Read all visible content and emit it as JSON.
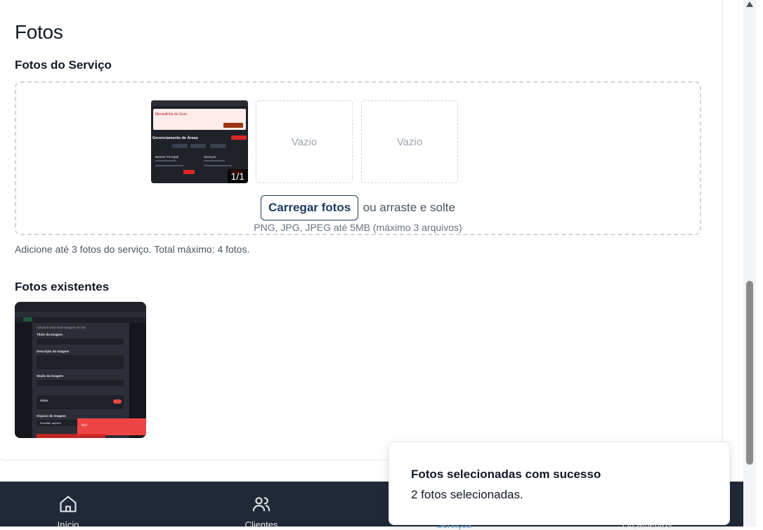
{
  "page": {
    "title": "Fotos",
    "service_photos_label": "Fotos do Serviço",
    "existing_photos_label": "Fotos existentes",
    "helper_text": "Adicione até 3 fotos do serviço. Total máximo: 4 fotos."
  },
  "dropzone": {
    "slots": [
      {
        "state": "filled",
        "counter": "1/1"
      },
      {
        "state": "empty",
        "label": "Vazio"
      },
      {
        "state": "empty",
        "label": "Vazio"
      }
    ],
    "upload_button": "Carregar fotos",
    "drag_text": "ou arraste e solte",
    "hint": "PNG, JPG, JPEG até 5MB (máximo 3 arquivos)"
  },
  "thumbnail_preview": {
    "title": "Gerenciamento de Áreas",
    "alert_title": "Mensalinha do Guru",
    "card1": "Banner Principal",
    "card2": "Serviços"
  },
  "existing_preview": {
    "lines": [
      "Adicione uma nova imagem ao site",
      "Título da Imagem",
      "Descrição da Imagem",
      "Seção da Imagem",
      "Ativa",
      "Arquivo de Imagem",
      "Escolher arquivo"
    ],
    "error_label": "Erro"
  },
  "bottom_nav": {
    "items": [
      {
        "label": "Início",
        "icon": "home-icon"
      },
      {
        "label": "Clientes",
        "icon": "users-icon"
      },
      {
        "label": "Serviços",
        "icon": "wrench-icon"
      },
      {
        "label": "Orçamentos",
        "icon": "file-icon"
      }
    ]
  },
  "toast": {
    "title": "Fotos selecionadas com sucesso",
    "description": "2 fotos selecionadas."
  },
  "colors": {
    "accent": "#1e3a5f",
    "nav_bg": "#1f2937",
    "nav_active": "#60a5fa",
    "error": "#ef4444"
  }
}
